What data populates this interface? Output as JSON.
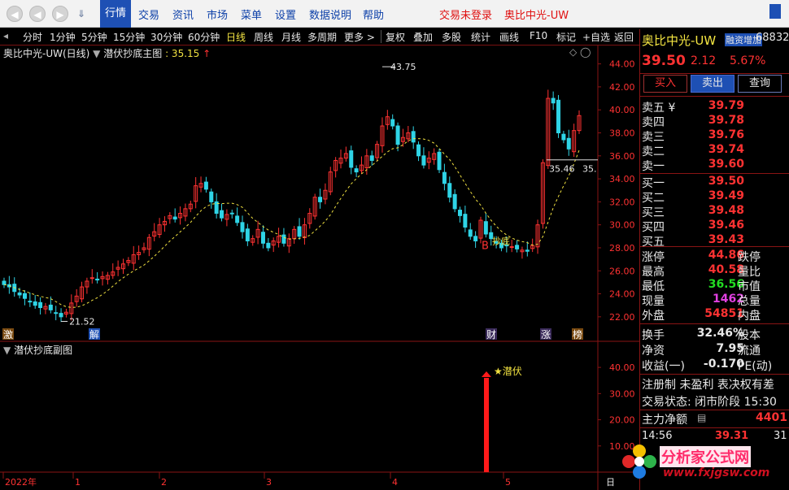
{
  "menu": {
    "back_icon": "left-arrow-icon",
    "forward_icon": "right-arrow-icon",
    "items": [
      "行情",
      "交易",
      "资讯",
      "市场",
      "菜单",
      "设置",
      "数据说明",
      "帮助"
    ],
    "trade_login": "交易未登录",
    "stock_name_title": "奥比中光-UW"
  },
  "toolbar": {
    "periods": [
      "分时",
      "1分钟",
      "5分钟",
      "15分钟",
      "30分钟",
      "60分钟",
      "日线",
      "周线",
      "月线",
      "多周期",
      "更多 >"
    ],
    "active_period": "日线",
    "tools": [
      "复权",
      "叠加",
      "多股",
      "统计",
      "画线",
      "F10",
      "标记",
      "+自选",
      "返回"
    ]
  },
  "main_chart": {
    "title": "奥比中光-UW(日线)",
    "indicator": "潜伏抄底主图",
    "indicator_value": ": 35.15",
    "y_ticks": [
      "44.00",
      "42.00",
      "40.00",
      "38.00",
      "36.00",
      "34.00",
      "32.00",
      "30.00",
      "28.00",
      "26.00",
      "24.00",
      "22.00"
    ],
    "annotations": {
      "high": "43.75",
      "low": "21.52",
      "right_price": "35.46",
      "right_price_tail": "35.",
      "signal": "B",
      "signal_text": "抄底"
    },
    "event_markers": [
      "激",
      "解",
      "财",
      "涨",
      "榜"
    ]
  },
  "sub_chart": {
    "title": "潜伏抄底副图",
    "y_ticks": [
      "40.00",
      "30.00",
      "20.00",
      "10.00"
    ],
    "signal_label": "★潜伏",
    "signal_value": 36
  },
  "x_axis": {
    "labels": [
      "2022年",
      "1",
      "2",
      "3",
      "4",
      "5"
    ],
    "right_label": "日"
  },
  "quote_panel": {
    "name": "奥比中光-UW",
    "badge": "融资增加",
    "code_partial": "68832",
    "price": "39.50",
    "change": "2.12",
    "change_pct": "5.67%",
    "buttons": [
      "买入",
      "卖出",
      "查询"
    ],
    "asks": [
      {
        "label": "卖五 ¥",
        "price": "39.79"
      },
      {
        "label": "卖四",
        "price": "39.78"
      },
      {
        "label": "卖三",
        "price": "39.76"
      },
      {
        "label": "卖二",
        "price": "39.74"
      },
      {
        "label": "卖一",
        "price": "39.60"
      }
    ],
    "bids": [
      {
        "label": "买一",
        "price": "39.50"
      },
      {
        "label": "买二",
        "price": "39.49"
      },
      {
        "label": "买三",
        "price": "39.48"
      },
      {
        "label": "买四",
        "price": "39.46"
      },
      {
        "label": "买五",
        "price": "39.43"
      }
    ],
    "stats": [
      {
        "label": "涨停",
        "value": "44.86",
        "color": "#ff3232",
        "label2": "跌停"
      },
      {
        "label": "最高",
        "value": "40.58",
        "color": "#ff3232",
        "label2": "量比"
      },
      {
        "label": "最低",
        "value": "36.56",
        "color": "#22dd22",
        "label2": "市值"
      },
      {
        "label": "现量",
        "value": "1462",
        "color": "#e040e0",
        "label2": "总量"
      },
      {
        "label": "外盘",
        "value": "54851",
        "color": "#ff3232",
        "label2": "内盘"
      }
    ],
    "stats2": [
      {
        "label": "换手",
        "value": "32.46%",
        "label2": "股本"
      },
      {
        "label": "净资",
        "value": "7.95",
        "label2": "流通"
      },
      {
        "label": "收益(一)",
        "value": "-0.170",
        "label2": "PE(动)"
      }
    ],
    "notice": "注册制 未盈利 表决权有差",
    "status": "交易状态: 闭市阶段 15:30",
    "flow_label": "主力净额",
    "flow_value": "4401",
    "tick_time": "14:56",
    "tick_price": "39.31",
    "tick_right": "31",
    "watermark_text": "分析家公式网",
    "watermark_url": "www.fxjgsw.com"
  },
  "colors": {
    "up": "#ff3232",
    "down": "#2fd4e6",
    "ma": "#f0e040",
    "frame": "#8a1414",
    "accent": "#1e50b4"
  }
}
